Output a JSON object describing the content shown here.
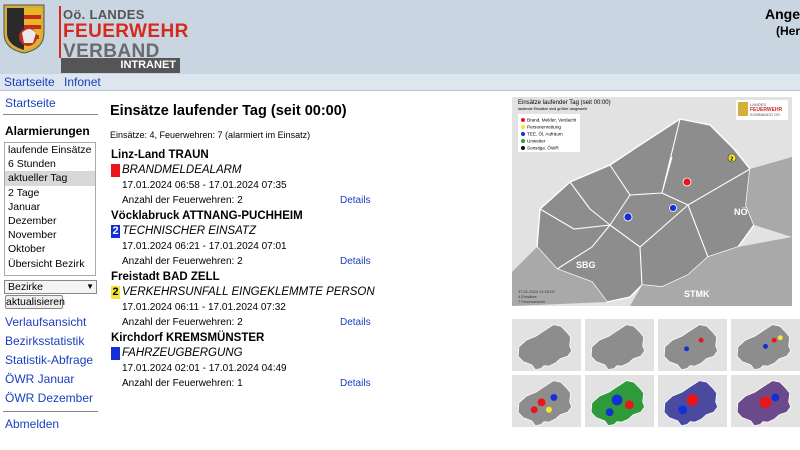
{
  "header": {
    "logo_line1": "Oö. LANDES",
    "logo_line2": "FEUERWEHR",
    "logo_line3": "VERBAND",
    "logo_badge": "INTRANET",
    "user_name": "Ange",
    "user_role": "(Her"
  },
  "topnav": {
    "items": [
      {
        "label": "Startseite"
      },
      {
        "label": "Infonet"
      }
    ]
  },
  "sidebar": {
    "start_label": "Startseite",
    "alarm_heading": "Alarmierungen",
    "alarm_list": [
      {
        "label": "laufende Einsätze",
        "selected": false
      },
      {
        "label": "6 Stunden",
        "selected": false
      },
      {
        "label": "aktueller Tag",
        "selected": true
      },
      {
        "label": "2 Tage",
        "selected": false
      },
      {
        "label": "Januar",
        "selected": false
      },
      {
        "label": "Dezember",
        "selected": false
      },
      {
        "label": "November",
        "selected": false
      },
      {
        "label": "Oktober",
        "selected": false
      },
      {
        "label": "Übersicht Bezirk",
        "selected": false
      }
    ],
    "select_value": "Bezirke",
    "refresh_label": "aktualisieren",
    "links": [
      {
        "label": "Verlaufsansicht"
      },
      {
        "label": "Bezirksstatistik"
      },
      {
        "label": "Statistik-Abfrage"
      },
      {
        "label": "ÖWR Januar"
      },
      {
        "label": "ÖWR Dezember"
      }
    ],
    "logout_label": "Abmelden"
  },
  "main": {
    "title": "Einsätze laufender Tag (seit 00:00)",
    "summary": "Einsätze: 4, Feuerwehren: 7 (alarmiert im Einsatz)",
    "details_label": "Details",
    "incidents": [
      {
        "location": "Linz-Land TRAUN",
        "badge": "",
        "badge_color": "#e8161b",
        "type": "BRANDMELDEALARM",
        "time": "17.01.2024 06:58 - 17.01.2024 07:35",
        "count": "Anzahl der Feuerwehren: 2"
      },
      {
        "location": "Vöcklabruck ATTNANG-PUCHHEIM",
        "badge": "2",
        "badge_color": "#1230d6",
        "type": "TECHNISCHER EINSATZ",
        "time": "17.01.2024 06:21 - 17.01.2024 07:01",
        "count": "Anzahl der Feuerwehren: 2"
      },
      {
        "location": "Freistadt BAD ZELL",
        "badge": "2",
        "badge_color": "#f5e633",
        "type": "VERKEHRSUNFALL EINGEKLEMMTE PERSON",
        "time": "17.01.2024 06:11 - 17.01.2024 07:32",
        "count": "Anzahl der Feuerwehren: 2"
      },
      {
        "location": "Kirchdorf KREMSMÜNSTER",
        "badge": "",
        "badge_color": "#1230d6",
        "type": "FAHRZEUGBERGUNG",
        "time": "17.01.2024 02:01 - 17.01.2024 04:49",
        "count": "Anzahl der Feuerwehren: 1"
      }
    ]
  },
  "map": {
    "title": "Einsätze laufender Tag (seit 00:00)",
    "subtitle": "laufende Einsätze sind größer dargestellt",
    "legend": [
      {
        "label": "Brand, Melder, Verdacht",
        "color": "#e8161b"
      },
      {
        "label": "Personenrettung",
        "color": "#f5e633"
      },
      {
        "label": "TEE, Öl, Aufräum",
        "color": "#1230d6"
      },
      {
        "label": "Unwetter",
        "color": "#2e9a3a"
      },
      {
        "label": "Sonstige, ÖWR",
        "color": "#111111"
      }
    ],
    "logo_line1": "LANDES",
    "logo_line2": "FEUERWEHR",
    "logo_line3": "KOMMANDO OÖ",
    "label_no": "NÖ",
    "label_sbg": "SBG",
    "label_stmk": "STMK",
    "footer1": "17.01.2024 14:15:00",
    "footer2": "4 Einsätze",
    "footer3": "7 Feuerwehren",
    "marker_badge": "2"
  }
}
